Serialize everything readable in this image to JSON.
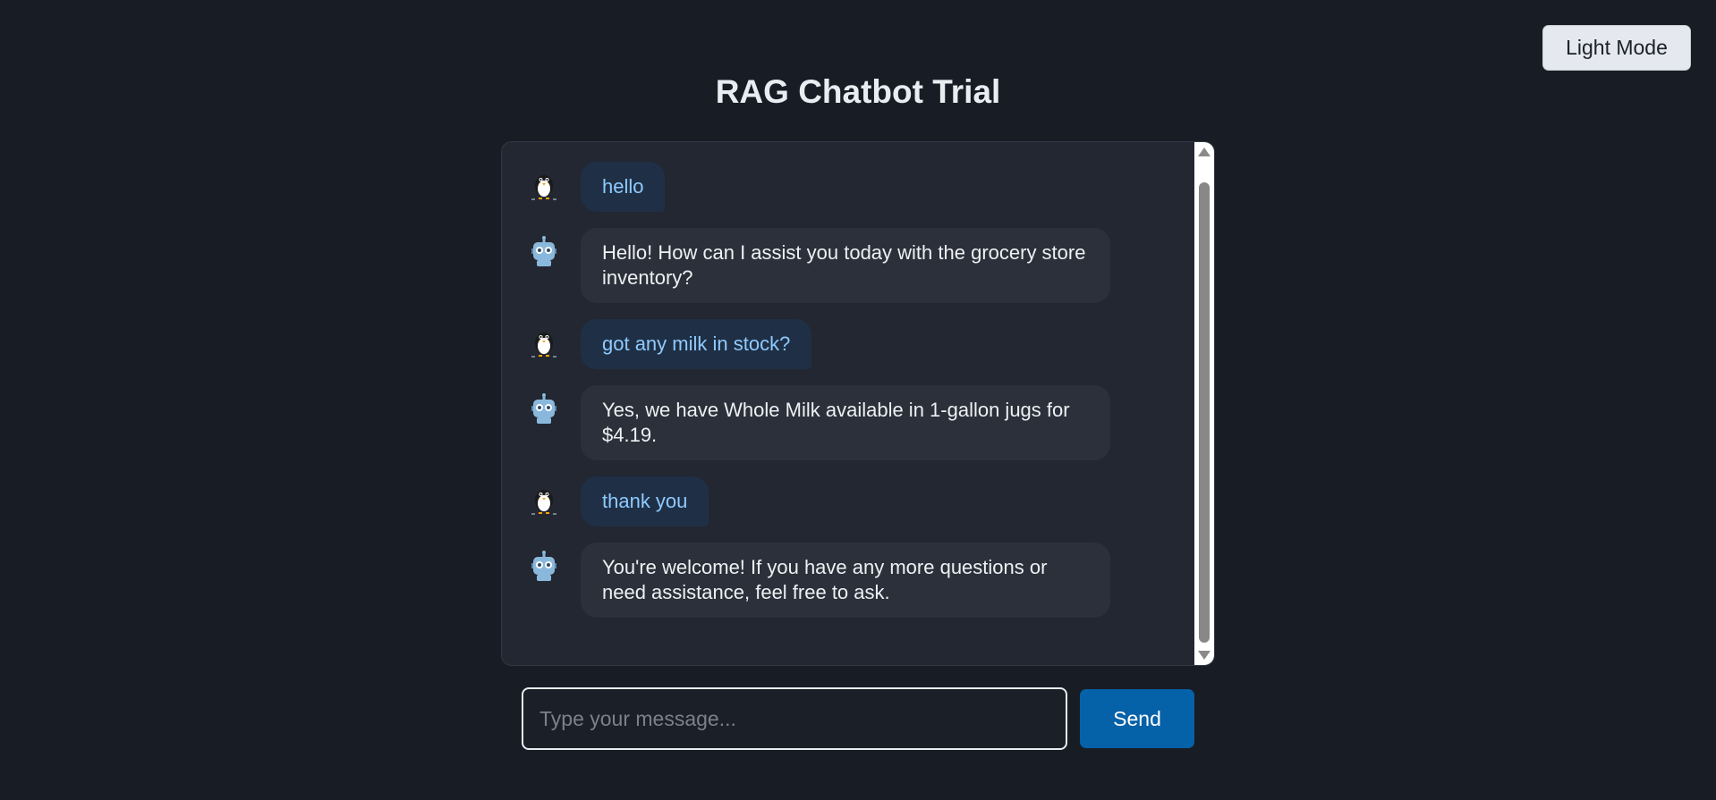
{
  "header": {
    "title": "RAG Chatbot Trial",
    "theme_toggle_label": "Light Mode"
  },
  "chat": {
    "messages": [
      {
        "role": "user",
        "avatar_icon": "penguin-icon",
        "text": "hello"
      },
      {
        "role": "bot",
        "avatar_icon": "robot-icon",
        "text": "Hello! How can I assist you today with the grocery store inventory?"
      },
      {
        "role": "user",
        "avatar_icon": "penguin-icon",
        "text": "got any milk in stock?"
      },
      {
        "role": "bot",
        "avatar_icon": "robot-icon",
        "text": "Yes, we have Whole Milk available in 1-gallon jugs for $4.19."
      },
      {
        "role": "user",
        "avatar_icon": "penguin-icon",
        "text": "thank you"
      },
      {
        "role": "bot",
        "avatar_icon": "robot-icon",
        "text": "You're welcome! If you have any more questions or need assistance, feel free to ask."
      }
    ]
  },
  "composer": {
    "input_value": "",
    "input_placeholder": "Type your message...",
    "send_label": "Send"
  },
  "colors": {
    "background": "#181c25",
    "panel": "#232731",
    "user_bubble": "#1f3046",
    "user_text": "#8fcaff",
    "bot_bubble": "#2c303a",
    "send_button": "#0561a8"
  }
}
